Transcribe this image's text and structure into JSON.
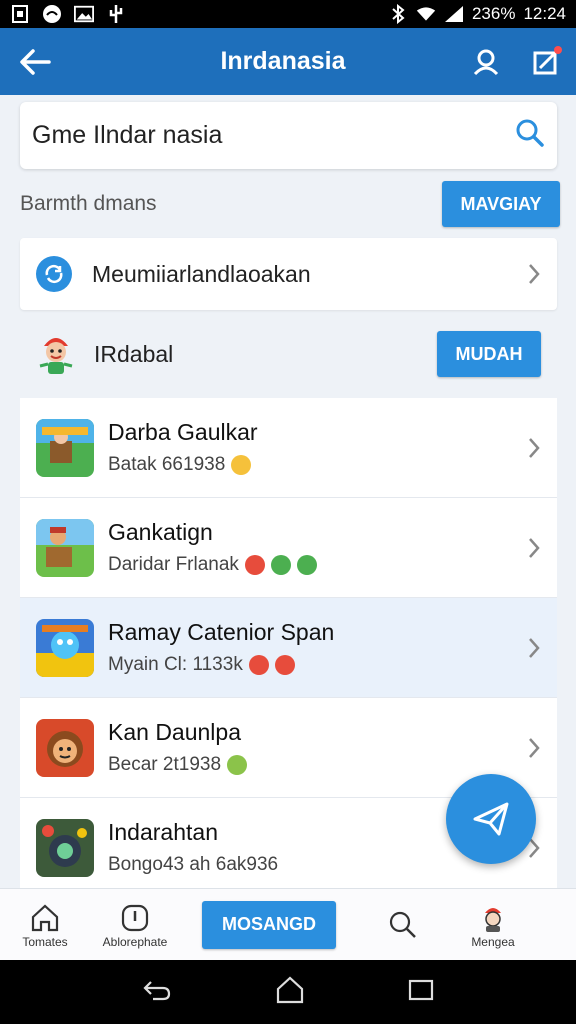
{
  "status_bar": {
    "battery": "236%",
    "time": "12:24"
  },
  "app_bar": {
    "title": "Inrdanasia"
  },
  "search": {
    "value": "Gme Ilndar nasia",
    "placeholder": ""
  },
  "section": {
    "label": "Barmth dmans",
    "button_label": "MAVGIAY"
  },
  "menu_row": {
    "label": "Meumiiarlandlaoakan"
  },
  "featured": {
    "label": "IRdabal",
    "button_label": "MUDAH"
  },
  "list_items": [
    {
      "title": "Darba Gaulkar",
      "subtitle": "Batak 661938"
    },
    {
      "title": "Gankatign",
      "subtitle": "Daridar Frlanak"
    },
    {
      "title": "Ramay Catenior Span",
      "subtitle": "Myain Cl: 1133k"
    },
    {
      "title": "Kan Daunlpa",
      "subtitle": "Becar 2t1938"
    },
    {
      "title": "Indarahtan",
      "subtitle": "Bongo43 ah 6ak936"
    }
  ],
  "bottom_nav": {
    "home_label": "Tomates",
    "alerts_label": "Ablorephate",
    "center_label": "MOSANGD",
    "profile_label": "Mengea"
  },
  "colors": {
    "app_bar": "#1e6fbb",
    "accent": "#2b8fde"
  }
}
